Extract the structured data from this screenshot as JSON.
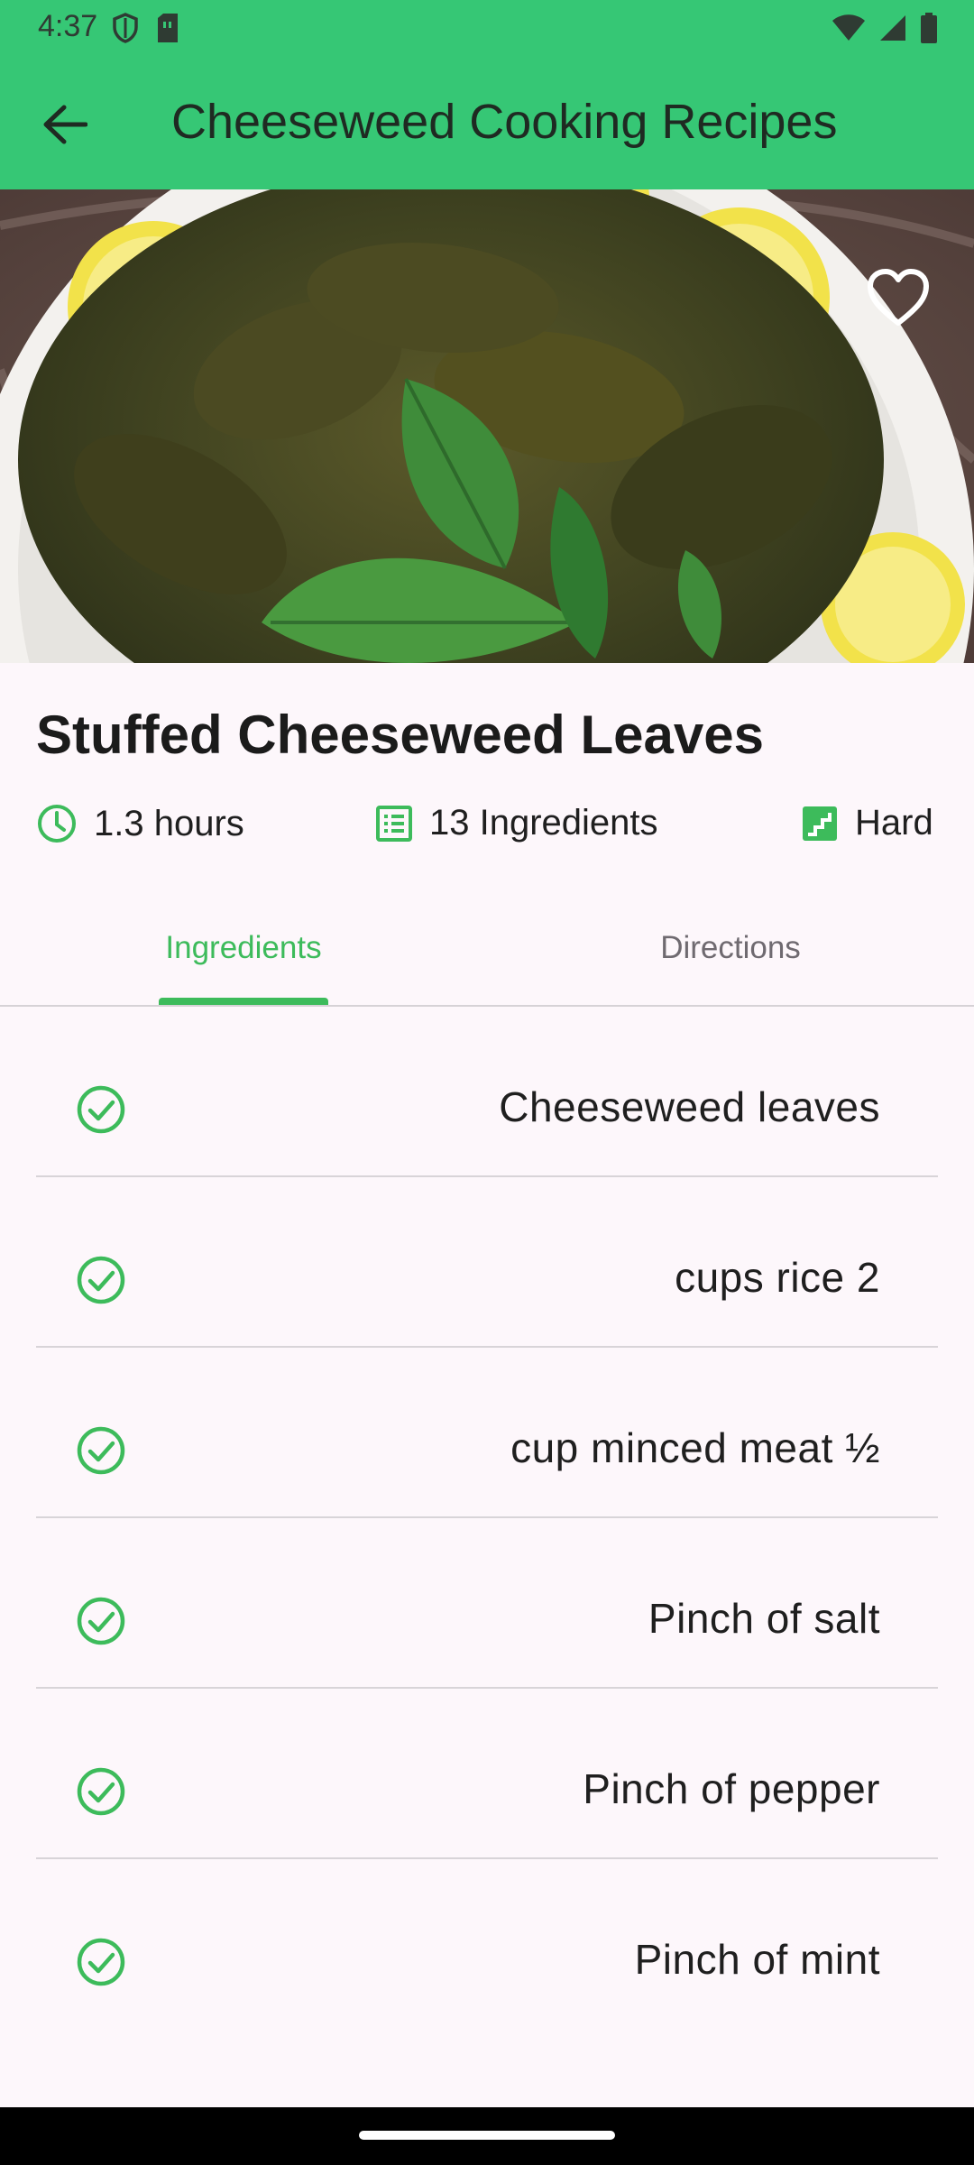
{
  "status_bar": {
    "time": "4:37"
  },
  "app_bar": {
    "title": "Cheeseweed Cooking Recipes"
  },
  "recipe": {
    "title": "Stuffed Cheeseweed Leaves",
    "meta": {
      "time": "1.3 hours",
      "ingredients_count": "13 Ingredients",
      "difficulty": "Hard"
    }
  },
  "tabs": [
    {
      "label": "Ingredients",
      "active": true
    },
    {
      "label": "Directions",
      "active": false
    }
  ],
  "ingredients": [
    "Cheeseweed leaves",
    "cups rice 2",
    "cup minced meat ½",
    "Pinch of salt",
    "Pinch of pepper",
    "Pinch of mint"
  ],
  "colors": {
    "app_bar": "#36c775",
    "accent_green": "#3dbb5b",
    "background": "#fdf7fb"
  }
}
